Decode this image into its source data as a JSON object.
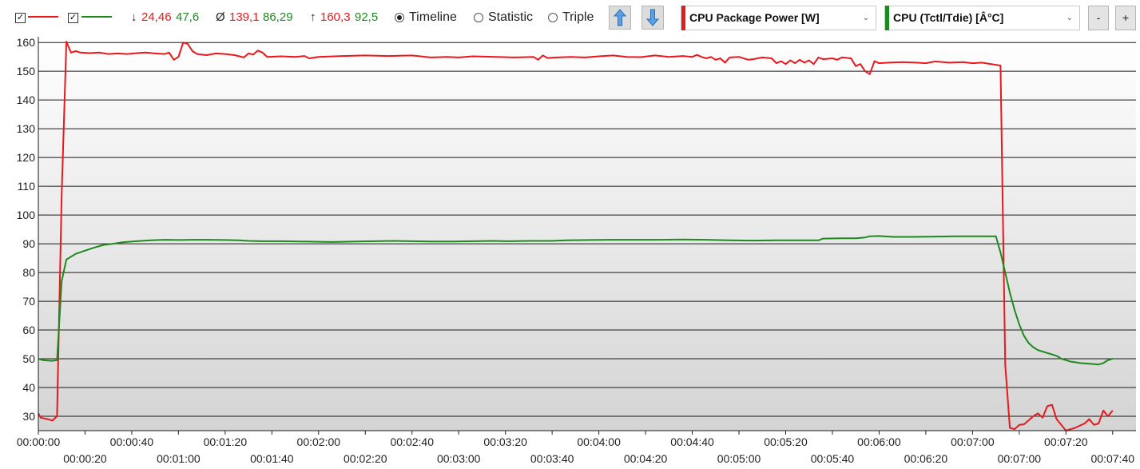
{
  "toolbar": {
    "series_checks": [
      {
        "checked": true,
        "mark": "✓",
        "color": "#e8181c"
      },
      {
        "checked": true,
        "mark": "✓",
        "color": "#1d8a1d"
      }
    ],
    "stats": {
      "min": {
        "symbol": "↓",
        "red": "24,46",
        "green": "47,6"
      },
      "avg": {
        "symbol": "Ø",
        "red": "139,1",
        "green": "86,29"
      },
      "max": {
        "symbol": "↑",
        "red": "160,3",
        "green": "92,5"
      }
    },
    "modes": [
      {
        "label": "Timeline",
        "selected": true
      },
      {
        "label": "Statistic",
        "selected": false
      },
      {
        "label": "Triple",
        "selected": false
      }
    ],
    "up_icon": "arrow-up-icon",
    "down_icon": "arrow-down-icon",
    "sensor_left": {
      "label": "CPU Package Power [W]",
      "color": "#e8181c"
    },
    "sensor_right": {
      "label": "CPU (Tctl/Tdie) [Â°C]",
      "color": "#1d8a1d"
    },
    "minus_label": "-",
    "plus_label": "+"
  },
  "chart_data": {
    "type": "line",
    "ylim": [
      25,
      162
    ],
    "xlim": [
      0,
      470
    ],
    "grid": true,
    "y_ticks": [
      30,
      40,
      50,
      60,
      70,
      80,
      90,
      100,
      110,
      120,
      130,
      140,
      150,
      160
    ],
    "x_ticks_top": [
      0,
      40,
      80,
      120,
      160,
      200,
      240,
      280,
      320,
      360,
      400,
      440
    ],
    "x_ticks_bottom": [
      20,
      60,
      100,
      140,
      180,
      220,
      260,
      300,
      340,
      380,
      420,
      460
    ],
    "x_tick_labels": {
      "0": "00:00:00",
      "20": "00:00:20",
      "40": "00:00:40",
      "60": "00:01:00",
      "80": "00:01:20",
      "100": "00:01:40",
      "120": "00:02:00",
      "140": "00:02:20",
      "160": "00:02:40",
      "180": "00:03:00",
      "200": "00:03:20",
      "220": "00:03:40",
      "240": "00:04:00",
      "260": "00:04:20",
      "280": "00:04:40",
      "300": "00:05:00",
      "320": "00:05:20",
      "340": "00:05:40",
      "360": "00:06:00",
      "380": "00:06:20",
      "400": "00:07:00",
      "420": "00:07:00",
      "440": "00:07:20",
      "460": "00:07:40"
    },
    "series": [
      {
        "color": "#e8181c",
        "points": [
          [
            0,
            31
          ],
          [
            1,
            29.5
          ],
          [
            4,
            29
          ],
          [
            6,
            28.5
          ],
          [
            8,
            30
          ],
          [
            10,
            107
          ],
          [
            12,
            160.3
          ],
          [
            14,
            156.5
          ],
          [
            16,
            157
          ],
          [
            18,
            156.5
          ],
          [
            22,
            156.3
          ],
          [
            26,
            156.5
          ],
          [
            30,
            156
          ],
          [
            34,
            156.2
          ],
          [
            38,
            156
          ],
          [
            42,
            156.3
          ],
          [
            46,
            156.5
          ],
          [
            50,
            156.2
          ],
          [
            54,
            156
          ],
          [
            56,
            156.5
          ],
          [
            58,
            154
          ],
          [
            60,
            155
          ],
          [
            62,
            160
          ],
          [
            64,
            159.5
          ],
          [
            66,
            157
          ],
          [
            68,
            156
          ],
          [
            72,
            155.6
          ],
          [
            76,
            156.2
          ],
          [
            80,
            156
          ],
          [
            84,
            155.6
          ],
          [
            88,
            154.8
          ],
          [
            90,
            156.2
          ],
          [
            92,
            155.8
          ],
          [
            94,
            157.2
          ],
          [
            96,
            156.5
          ],
          [
            98,
            155
          ],
          [
            104,
            155.2
          ],
          [
            110,
            155
          ],
          [
            114,
            155.3
          ],
          [
            116,
            154.5
          ],
          [
            120,
            155
          ],
          [
            130,
            155.3
          ],
          [
            140,
            155.5
          ],
          [
            150,
            155.3
          ],
          [
            160,
            155.5
          ],
          [
            168,
            154.8
          ],
          [
            175,
            155
          ],
          [
            180,
            154.8
          ],
          [
            186,
            155.2
          ],
          [
            196,
            155
          ],
          [
            204,
            154.8
          ],
          [
            212,
            155
          ],
          [
            214,
            154
          ],
          [
            216,
            155.5
          ],
          [
            218,
            154.6
          ],
          [
            222,
            154.8
          ],
          [
            228,
            155
          ],
          [
            234,
            154.8
          ],
          [
            240,
            155.2
          ],
          [
            246,
            155.5
          ],
          [
            252,
            155
          ],
          [
            258,
            154.9
          ],
          [
            264,
            155.5
          ],
          [
            270,
            155
          ],
          [
            276,
            155.3
          ],
          [
            280,
            155
          ],
          [
            282,
            155.7
          ],
          [
            284,
            155
          ],
          [
            286,
            154.5
          ],
          [
            288,
            155
          ],
          [
            290,
            154
          ],
          [
            292,
            154.5
          ],
          [
            294,
            153
          ],
          [
            296,
            154.8
          ],
          [
            300,
            155
          ],
          [
            304,
            154
          ],
          [
            306,
            154.2
          ],
          [
            310,
            154.8
          ],
          [
            314,
            154.5
          ],
          [
            316,
            152.8
          ],
          [
            318,
            153.5
          ],
          [
            320,
            152.5
          ],
          [
            322,
            153.8
          ],
          [
            324,
            152.8
          ],
          [
            326,
            154
          ],
          [
            328,
            153
          ],
          [
            330,
            153.8
          ],
          [
            332,
            152.5
          ],
          [
            334,
            154.8
          ],
          [
            336,
            154.2
          ],
          [
            340,
            154.5
          ],
          [
            342,
            154
          ],
          [
            344,
            154.8
          ],
          [
            348,
            154.5
          ],
          [
            350,
            151.8
          ],
          [
            352,
            152.5
          ],
          [
            354,
            150
          ],
          [
            356,
            149
          ],
          [
            358,
            153.5
          ],
          [
            360,
            152.8
          ],
          [
            364,
            153
          ],
          [
            370,
            153.2
          ],
          [
            376,
            153
          ],
          [
            380,
            152.8
          ],
          [
            384,
            153.4
          ],
          [
            390,
            153
          ],
          [
            396,
            153.2
          ],
          [
            400,
            152.8
          ],
          [
            404,
            153
          ],
          [
            408,
            152.5
          ],
          [
            412,
            152
          ],
          [
            414,
            48
          ],
          [
            416,
            26
          ],
          [
            418,
            25.5
          ],
          [
            420,
            27
          ],
          [
            422,
            27.2
          ],
          [
            426,
            30
          ],
          [
            428,
            31
          ],
          [
            430,
            29.5
          ],
          [
            432,
            33.5
          ],
          [
            434,
            34
          ],
          [
            436,
            29
          ],
          [
            438,
            27
          ],
          [
            440,
            25
          ],
          [
            442,
            25.5
          ],
          [
            444,
            26
          ],
          [
            448,
            27.5
          ],
          [
            450,
            29
          ],
          [
            452,
            27
          ],
          [
            454,
            27.5
          ],
          [
            456,
            32
          ],
          [
            458,
            30
          ],
          [
            460,
            32
          ]
        ]
      },
      {
        "color": "#1d8a1d",
        "points": [
          [
            0,
            50
          ],
          [
            2,
            49.5
          ],
          [
            6,
            49.3
          ],
          [
            8,
            49.5
          ],
          [
            10,
            77
          ],
          [
            12,
            84.5
          ],
          [
            16,
            86.5
          ],
          [
            20,
            87.6
          ],
          [
            24,
            88.7
          ],
          [
            28,
            89.6
          ],
          [
            32,
            90
          ],
          [
            36,
            90.5
          ],
          [
            42,
            90.9
          ],
          [
            48,
            91.2
          ],
          [
            54,
            91.4
          ],
          [
            60,
            91.3
          ],
          [
            66,
            91.4
          ],
          [
            72,
            91.4
          ],
          [
            80,
            91.3
          ],
          [
            86,
            91.2
          ],
          [
            90,
            91
          ],
          [
            96,
            90.9
          ],
          [
            104,
            90.9
          ],
          [
            112,
            90.8
          ],
          [
            120,
            90.7
          ],
          [
            126,
            90.6
          ],
          [
            130,
            90.7
          ],
          [
            136,
            90.8
          ],
          [
            144,
            90.9
          ],
          [
            152,
            91
          ],
          [
            160,
            90.9
          ],
          [
            168,
            90.8
          ],
          [
            178,
            90.8
          ],
          [
            186,
            90.9
          ],
          [
            194,
            91
          ],
          [
            202,
            90.9
          ],
          [
            210,
            91
          ],
          [
            220,
            91
          ],
          [
            226,
            91.2
          ],
          [
            236,
            91.3
          ],
          [
            246,
            91.4
          ],
          [
            256,
            91.4
          ],
          [
            266,
            91.4
          ],
          [
            276,
            91.5
          ],
          [
            286,
            91.4
          ],
          [
            296,
            91.2
          ],
          [
            306,
            91.1
          ],
          [
            316,
            91.2
          ],
          [
            326,
            91.2
          ],
          [
            334,
            91.2
          ],
          [
            336,
            91.8
          ],
          [
            344,
            91.9
          ],
          [
            350,
            91.9
          ],
          [
            354,
            92.2
          ],
          [
            356,
            92.6
          ],
          [
            360,
            92.7
          ],
          [
            366,
            92.4
          ],
          [
            374,
            92.4
          ],
          [
            384,
            92.5
          ],
          [
            392,
            92.6
          ],
          [
            400,
            92.6
          ],
          [
            406,
            92.6
          ],
          [
            410,
            92.6
          ],
          [
            412,
            87
          ],
          [
            414,
            80
          ],
          [
            416,
            73
          ],
          [
            418,
            67
          ],
          [
            420,
            62
          ],
          [
            422,
            58
          ],
          [
            424,
            55.5
          ],
          [
            426,
            54
          ],
          [
            428,
            53
          ],
          [
            430,
            52.5
          ],
          [
            432,
            52
          ],
          [
            434,
            51.5
          ],
          [
            436,
            51
          ],
          [
            438,
            50
          ],
          [
            440,
            49.5
          ],
          [
            442,
            49
          ],
          [
            444,
            48.8
          ],
          [
            446,
            48.5
          ],
          [
            450,
            48.3
          ],
          [
            454,
            48
          ],
          [
            456,
            48.5
          ],
          [
            458,
            49.5
          ],
          [
            460,
            50
          ]
        ]
      }
    ]
  }
}
